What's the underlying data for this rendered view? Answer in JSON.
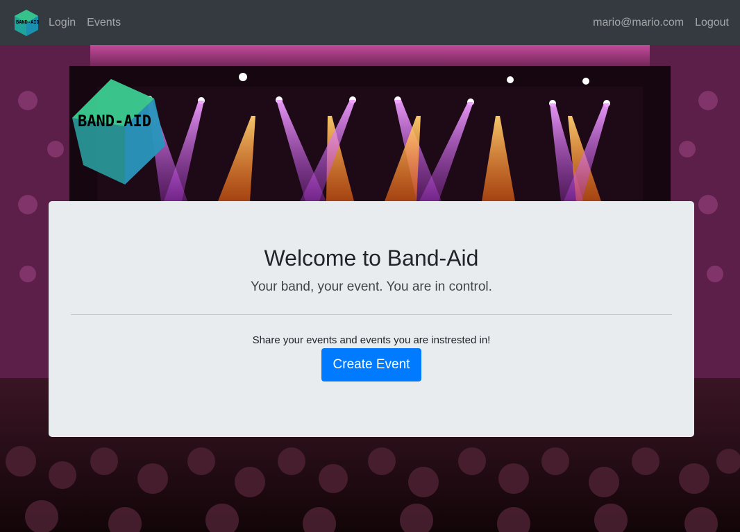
{
  "navbar": {
    "brand_icon": "band-aid-logo-icon",
    "brand_text": "BAND-AID",
    "links": [
      "Login",
      "Events"
    ],
    "user_email": "mario@mario.com",
    "logout_label": "Logout"
  },
  "hero": {
    "logo_text": "BAND-AID"
  },
  "jumbotron": {
    "title": "Welcome to Band-Aid",
    "lead": "Your band, your event. You are in control.",
    "text": "Share your events and events you are instrested in!",
    "button_label": "Create Event"
  },
  "colors": {
    "navbar_bg": "#343a40",
    "primary": "#007bff",
    "jumbotron_bg": "#e9ecef",
    "logo_green": "#2bbf7a",
    "logo_teal": "#2aa6a6"
  }
}
